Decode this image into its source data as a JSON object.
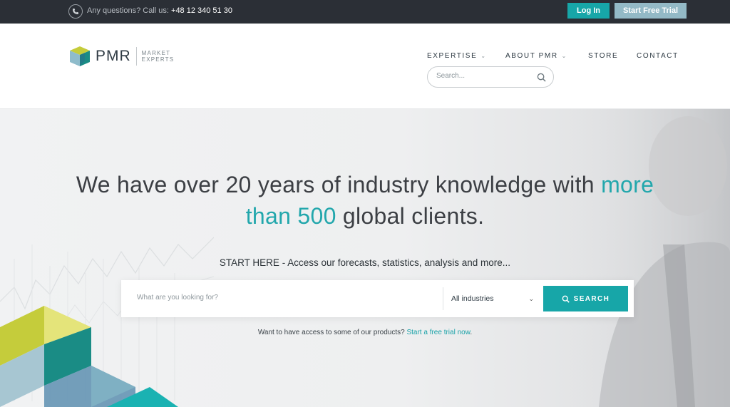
{
  "topbar": {
    "questions_label": "Any questions? Call us:",
    "phone": "+48 12 340 51 30",
    "login_label": "Log In",
    "trial_label": "Start Free Trial"
  },
  "header": {
    "logo_text": "PMR",
    "logo_sub_line1": "MARKET",
    "logo_sub_line2": "EXPERTS",
    "nav": {
      "expertise": "EXPERTISE",
      "about": "ABOUT PMR",
      "store": "STORE",
      "contact": "CONTACT"
    },
    "search_placeholder": "Search..."
  },
  "hero": {
    "headline_part1": "We have over 20 years of industry knowledge with ",
    "headline_accent_1": "more",
    "headline_accent_2": "than 500",
    "headline_part2": " global clients.",
    "start_here": "START HERE - Access our forecasts, statistics, analysis and more...",
    "search_placeholder": "What are you looking for?",
    "industry_selected": "All industries",
    "search_button": "SEARCH",
    "trial_prompt": "Want to have access to some of our products?",
    "trial_link": "Start a free trial now",
    "trial_suffix": "."
  },
  "colors": {
    "accent": "#17a6a8",
    "topbar_bg": "#2b2f36",
    "trial_button": "#93b9c6",
    "logo_lime": "#c5cc3b",
    "logo_teal": "#1a8c85",
    "logo_blue": "#5d8fb0"
  },
  "icons": {
    "phone": "phone-icon",
    "search": "search-icon",
    "chevron": "chevron-down-icon"
  }
}
